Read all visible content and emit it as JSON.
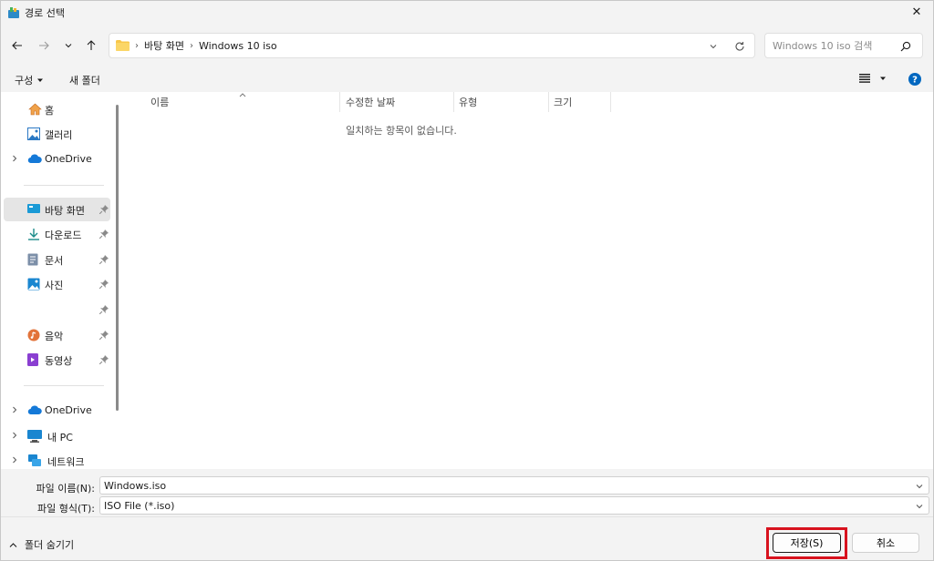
{
  "window": {
    "title": "경로 선택",
    "close_symbol": "✕"
  },
  "address_bar": {
    "crumbs": [
      "바탕 화면",
      "Windows 10 iso"
    ]
  },
  "search": {
    "placeholder": "Windows 10 iso 검색"
  },
  "toolbar": {
    "organize_label": "구성",
    "new_folder_label": "새 폴더"
  },
  "sidebar": {
    "items": [
      {
        "label": "홈",
        "icon": "home-icon"
      },
      {
        "label": "갤러리",
        "icon": "gallery-icon"
      },
      {
        "label": "OneDrive",
        "icon": "cloud-icon"
      },
      {
        "label": "바탕 화면",
        "icon": "desktop-icon"
      },
      {
        "label": "다운로드",
        "icon": "download-icon"
      },
      {
        "label": "문서",
        "icon": "document-icon"
      },
      {
        "label": "사진",
        "icon": "picture-icon"
      },
      {
        "label": "",
        "icon": "pin-icon"
      },
      {
        "label": "음악",
        "icon": "music-icon"
      },
      {
        "label": "동영상",
        "icon": "video-icon"
      },
      {
        "label": "OneDrive",
        "icon": "cloud-icon"
      },
      {
        "label": "내 PC",
        "icon": "pc-icon"
      },
      {
        "label": "네트워크",
        "icon": "network-icon"
      }
    ]
  },
  "file_list": {
    "columns": [
      "이름",
      "수정한 날짜",
      "유형",
      "크기"
    ],
    "empty_message": "일치하는 항목이 없습니다."
  },
  "form": {
    "filename_label": "파일 이름(N):",
    "filename_value": "Windows.iso",
    "filetype_label": "파일 형식(T):",
    "filetype_value": "ISO File (*.iso)"
  },
  "footer": {
    "hide_folders_label": "폴더 숨기기",
    "save_label": "저장(S)",
    "cancel_label": "취소"
  },
  "colors": {
    "highlight": "#d8121e",
    "help": "#0067c0",
    "folder": "#f8c74a"
  }
}
